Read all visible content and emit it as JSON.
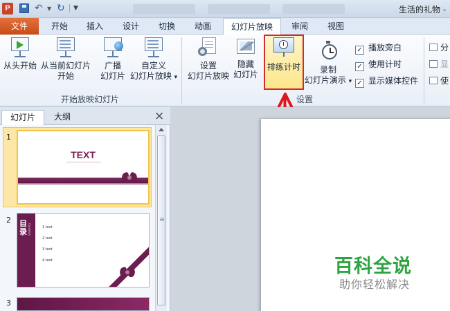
{
  "app": {
    "window_title": "生活的礼物 -",
    "logo_letter": "P"
  },
  "tabs": {
    "file": "文件",
    "items": [
      "开始",
      "插入",
      "设计",
      "切换",
      "动画",
      "幻灯片放映",
      "审阅",
      "视图"
    ],
    "active": "幻灯片放映"
  },
  "ribbon": {
    "groups": {
      "start_show": {
        "label": "开始放映幻灯片",
        "from_beginning": "从头开始",
        "from_current_1": "从当前幻灯片",
        "from_current_2": "开始",
        "broadcast_1": "广播",
        "broadcast_2": "幻灯片",
        "custom_1": "自定义",
        "custom_2": "幻灯片放映",
        "dropdown_glyph": "▾"
      },
      "setup": {
        "label": "设置",
        "setup_show_1": "设置",
        "setup_show_2": "幻灯片放映",
        "hide_1": "隐藏",
        "hide_2": "幻灯片",
        "rehearse": "排练计时",
        "record_1": "录制",
        "record_2": "幻灯片演示",
        "checks": [
          {
            "label": "播放旁白",
            "checked": true
          },
          {
            "label": "使用计时",
            "checked": true
          },
          {
            "label": "显示媒体控件",
            "checked": true
          }
        ]
      },
      "monitors_cut": {
        "items": [
          "分",
          "显",
          "使"
        ]
      }
    }
  },
  "panel": {
    "tab_slides": "幻灯片",
    "tab_outline": "大纲",
    "close_glyph": "×",
    "slides": [
      {
        "num": "1",
        "title": "TEXT",
        "selected": true
      },
      {
        "num": "2",
        "side_title": "目录",
        "side_sub": "Contents",
        "items": [
          "1  text",
          "2  text",
          "3  text",
          "4  text"
        ]
      },
      {
        "num": "3"
      }
    ]
  },
  "watermark": {
    "title": "百科全说",
    "subtitle": "助你轻松解决"
  },
  "colors": {
    "file_tab": "#d65a22",
    "ribbon_highlight": "#fde68c",
    "annotation_red": "#e0151c",
    "slide_maroon": "#6c1d4f",
    "watermark_green": "#2ca540"
  }
}
